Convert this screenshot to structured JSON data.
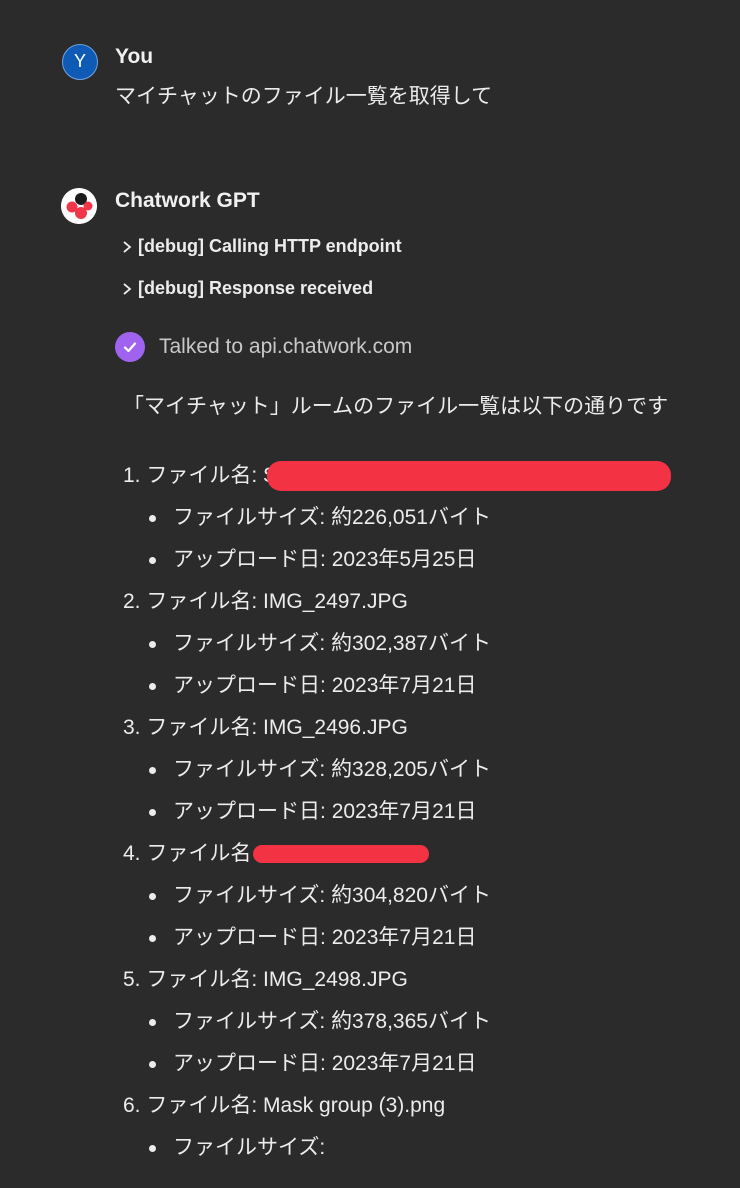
{
  "user": {
    "avatar_letter": "Y",
    "name": "You",
    "message": "マイチャットのファイル一覧を取得して"
  },
  "assistant": {
    "name": "Chatwork GPT",
    "debug_items": [
      {
        "label": "[debug] Calling HTTP endpoint"
      },
      {
        "label": "[debug] Response received"
      }
    ],
    "talked_to": "Talked to api.chatwork.com",
    "intro": "「マイチャット」ルームのファイル一覧は以下の通りです",
    "files": [
      {
        "number": "1.",
        "name_label": "ファイル名:",
        "name": "S",
        "redacted": true,
        "size_label": "ファイルサイズ:",
        "size": "約226,051バイト",
        "date_label": "アップロード日:",
        "date": "2023年5月25日"
      },
      {
        "number": "2.",
        "name_label": "ファイル名:",
        "name": "IMG_2497.JPG",
        "redacted": false,
        "size_label": "ファイルサイズ:",
        "size": "約302,387バイト",
        "date_label": "アップロード日:",
        "date": "2023年7月21日"
      },
      {
        "number": "3.",
        "name_label": "ファイル名:",
        "name": "IMG_2496.JPG",
        "redacted": false,
        "size_label": "ファイルサイズ:",
        "size": "約328,205バイト",
        "date_label": "アップロード日:",
        "date": "2023年7月21日"
      },
      {
        "number": "4.",
        "name_label": "ファイル名",
        "name": "",
        "redacted": true,
        "size_label": "ファイルサイズ:",
        "size": "約304,820バイト",
        "date_label": "アップロード日:",
        "date": "2023年7月21日"
      },
      {
        "number": "5.",
        "name_label": "ファイル名:",
        "name": "IMG_2498.JPG",
        "redacted": false,
        "size_label": "ファイルサイズ:",
        "size": "約378,365バイト",
        "date_label": "アップロード日:",
        "date": "2023年7月21日"
      },
      {
        "number": "6.",
        "name_label": "ファイル名:",
        "name": "Mask group (3).png",
        "redacted": false,
        "size_label": "ファイルサイズ:",
        "size": "",
        "date_label": "",
        "date": ""
      }
    ]
  },
  "colors": {
    "background": "#2b2b2b",
    "user_avatar": "#0f5ab4",
    "check_badge": "#a063ef",
    "redaction": "#f33244"
  }
}
